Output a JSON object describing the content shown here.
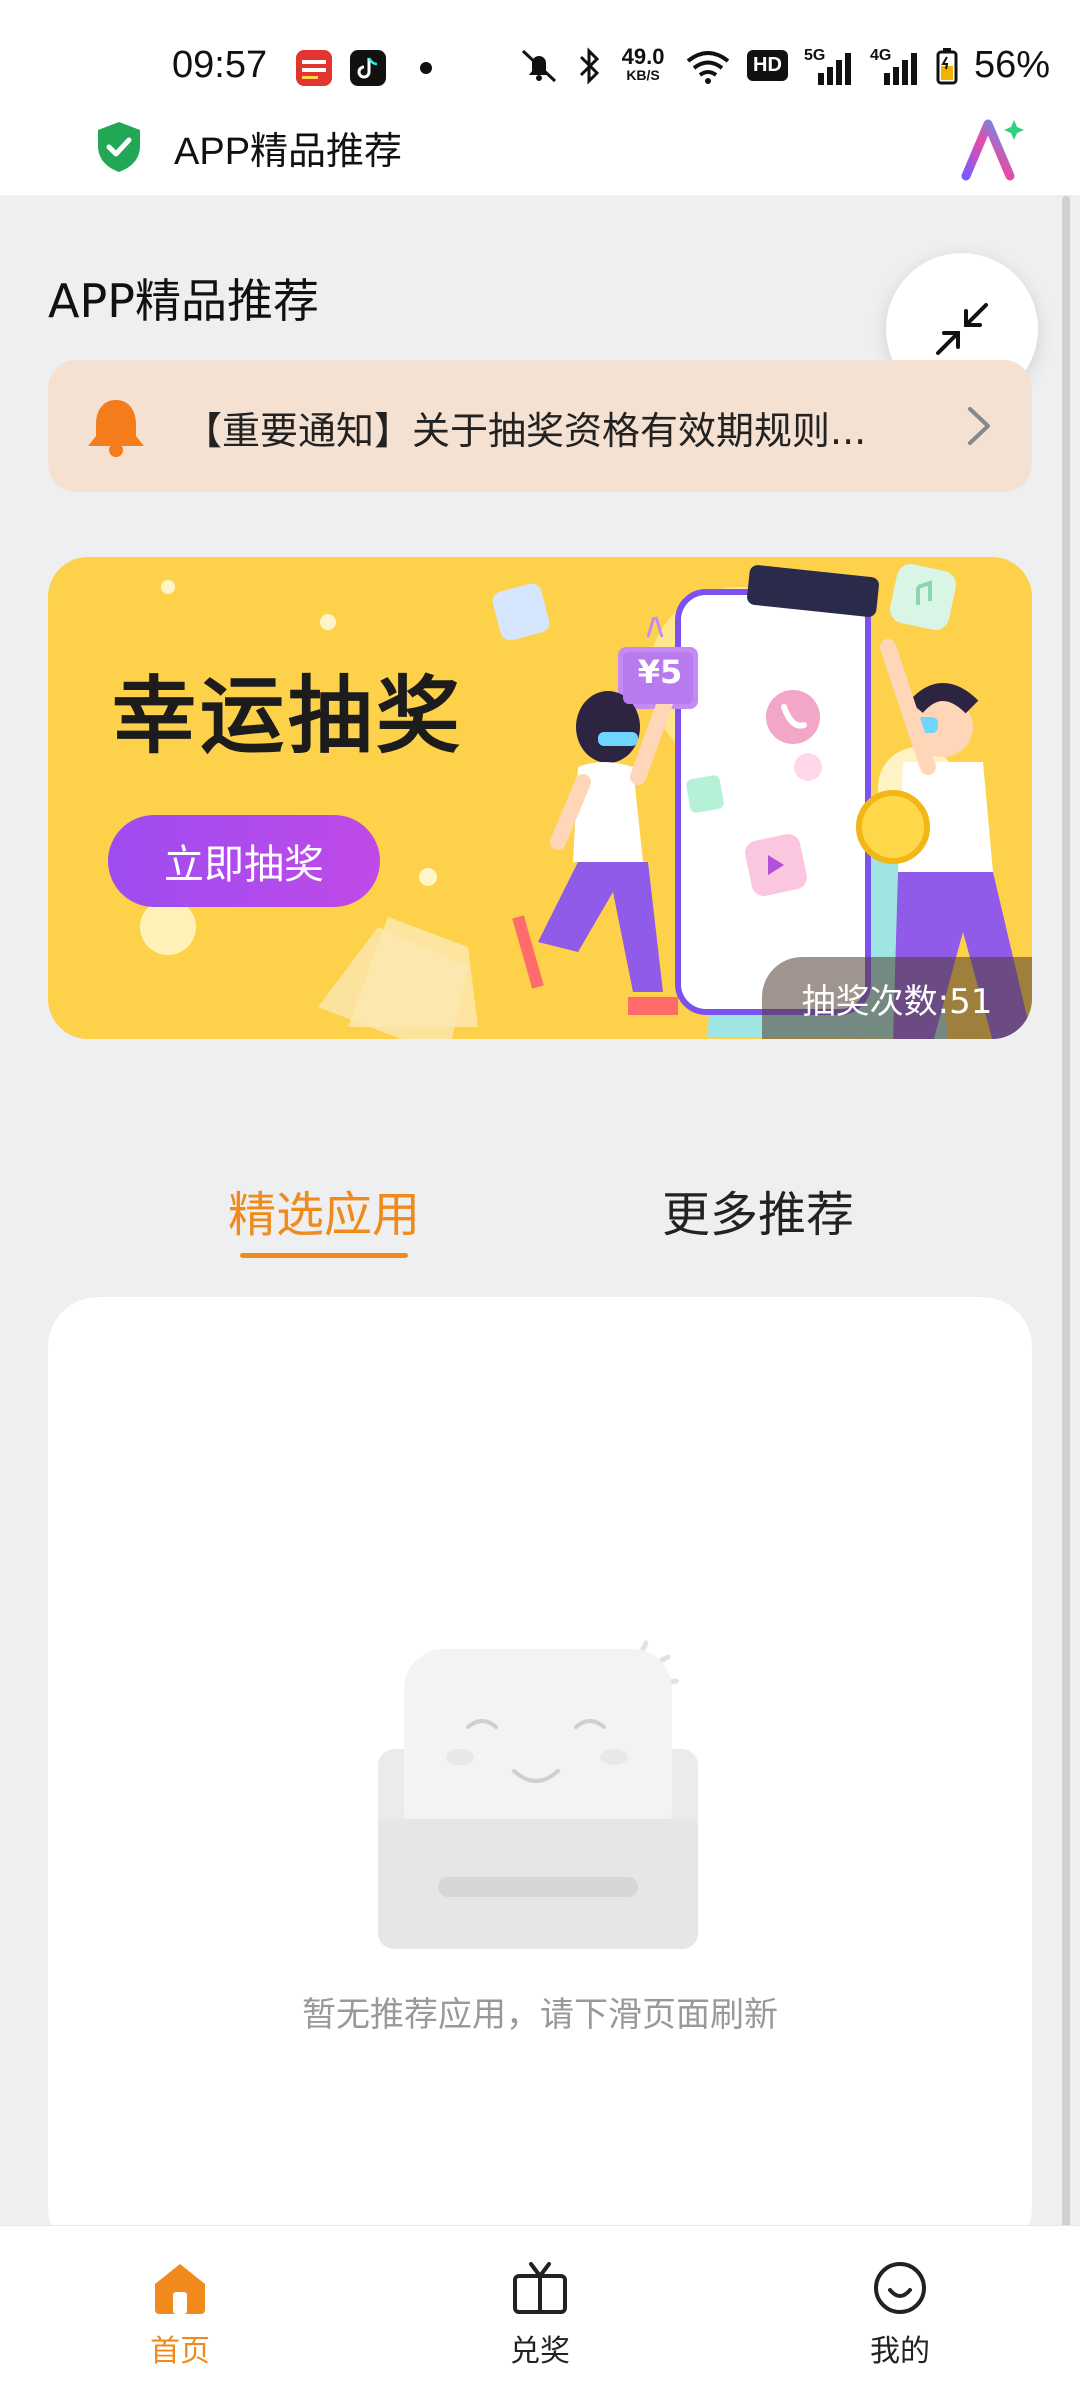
{
  "status_bar": {
    "time": "09:57",
    "app_icons": [
      "toutiao-icon",
      "douyin-icon"
    ],
    "net_speed_value": "49.0",
    "net_speed_unit": "KB/S",
    "hd_label": "HD",
    "sim1_label": "5G",
    "sim2_label": "4G",
    "battery": "56%"
  },
  "title_bar": {
    "title": "APP精品推荐"
  },
  "page": {
    "heading": "APP精品推荐"
  },
  "notice": {
    "text": "【重要通知】关于抽奖资格有效期规则..."
  },
  "banner": {
    "title": "幸运抽奖",
    "button_label": "立即抽奖",
    "draw_count_label": "抽奖次数:51",
    "coupon_label": "¥5"
  },
  "tabs": {
    "items": [
      {
        "label": "精选应用",
        "active": true
      },
      {
        "label": "更多推荐",
        "active": false
      }
    ]
  },
  "empty_state": {
    "message": "暂无推荐应用，请下滑页面刷新"
  },
  "bottom_nav": {
    "items": [
      {
        "label": "首页",
        "icon": "home-icon",
        "active": true
      },
      {
        "label": "兑奖",
        "icon": "prize-box-icon",
        "active": false
      },
      {
        "label": "我的",
        "icon": "smile-profile-icon",
        "active": false
      }
    ]
  },
  "colors": {
    "accent": "#f08a1c",
    "banner_bg": "#fdd24a",
    "button_purple": "#9d4cf0",
    "notice_bg": "#f5e1d2",
    "shield_green": "#22a755"
  }
}
